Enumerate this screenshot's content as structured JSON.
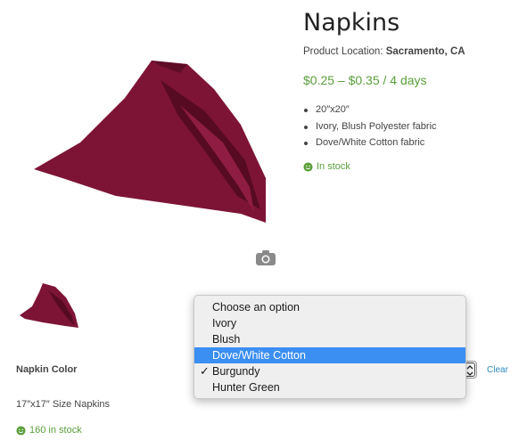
{
  "product": {
    "title": "Napkins",
    "location_label": "Product Location:",
    "location_value": "Sacramento, CA",
    "price": "$0.25 – $0.35 / 4 days",
    "features": [
      "20″x20″",
      "Ivory, Blush Polyester fabric",
      "Dove/White Cotton fabric"
    ],
    "stock_status": "In stock"
  },
  "gallery": {
    "image_alt": "burgundy-napkin",
    "zoom_icon": "camera-icon"
  },
  "variations": {
    "color_label": "Napkin Color",
    "clear_label": "Clear",
    "dropdown": {
      "options": [
        "Choose an option",
        "Ivory",
        "Blush",
        "Dove/White Cotton",
        "Burgundy",
        "Hunter Green"
      ],
      "highlighted": "Dove/White Cotton",
      "checked": "Burgundy"
    }
  },
  "sub_product": {
    "size_text": "17″x17″ Size Napkins",
    "stock_text": "160 in stock"
  },
  "colors": {
    "accent_green": "#5a9e3a",
    "napkin_burgundy": "#7d1436",
    "link_blue": "#2a8abf",
    "highlight_blue": "#3b8ef2"
  }
}
